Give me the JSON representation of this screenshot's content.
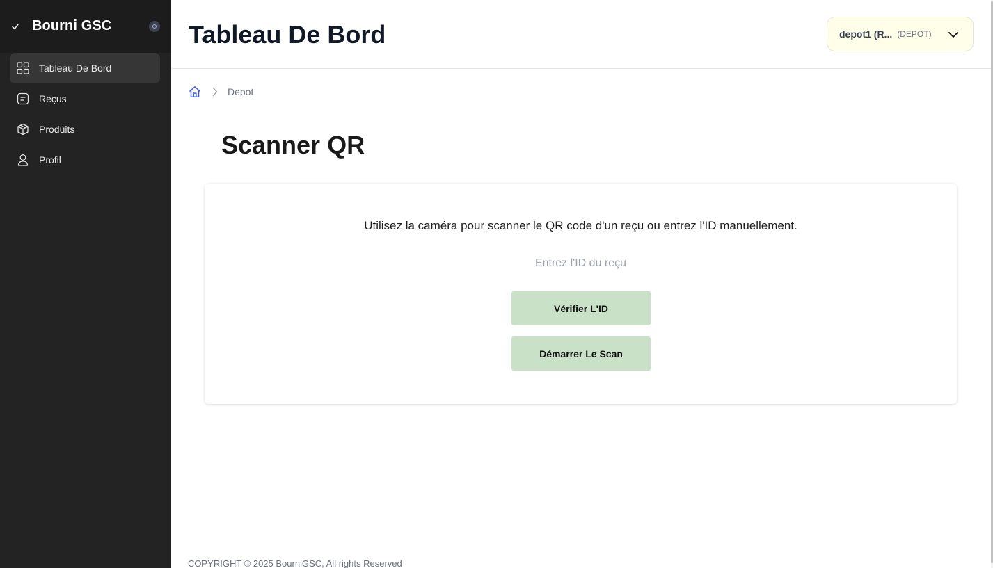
{
  "brand": {
    "title": "Bourni GSC"
  },
  "sidebar": {
    "items": [
      {
        "label": "Tableau De Bord",
        "icon": "grid-icon",
        "active": true
      },
      {
        "label": "Reçus",
        "icon": "receipt-icon",
        "active": false
      },
      {
        "label": "Produits",
        "icon": "box-icon",
        "active": false
      },
      {
        "label": "Profil",
        "icon": "user-icon",
        "active": false
      }
    ]
  },
  "header": {
    "title": "Tableau De Bord",
    "user": {
      "name": "depot1 (R...",
      "role": "(DEPOT)"
    }
  },
  "breadcrumb": {
    "current": "Depot"
  },
  "scanner": {
    "title": "Scanner QR",
    "description": "Utilisez la caméra pour scanner le QR code d'un reçu ou entrez l'ID manuellement.",
    "input_placeholder": "Entrez l'ID du reçu",
    "input_value": "",
    "verify_label": "Vérifier L'ID",
    "scan_label": "Démarrer Le Scan"
  },
  "footer": {
    "text": "COPYRIGHT © 2025 BourniGSC, All rights Reserved"
  },
  "colors": {
    "sidebar_bg": "#232323",
    "active_item_bg": "#363636",
    "button_bg": "#c9e2c7",
    "user_select_bg": "#fefee9",
    "home_icon": "#3b5bdb"
  }
}
